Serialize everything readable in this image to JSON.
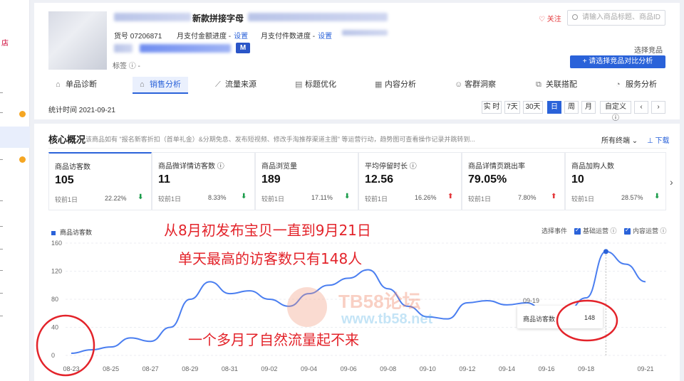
{
  "product": {
    "title": "新款拼接字母",
    "sku_label": "货号 07206871",
    "monthly_amount_progress": "月支付金额进度 -",
    "monthly_count_progress": "月支付件数进度 -",
    "set_label": "设置",
    "badge": "M",
    "tag_line": "标签 ⓘ   -"
  },
  "header": {
    "follow": "♡ 关注",
    "search_placeholder": "请输入商品标题、商品ID",
    "choose_label": "选择竞品",
    "compare_button": "+ 请选择竞品对比分析"
  },
  "tabs": [
    {
      "label": "单品诊断",
      "icon": "⌂"
    },
    {
      "label": "销售分析",
      "icon": "⌂"
    },
    {
      "label": "流量来源",
      "icon": "⟋"
    },
    {
      "label": "标题优化",
      "icon": "▤"
    },
    {
      "label": "内容分析",
      "icon": "▦"
    },
    {
      "label": "客群洞察",
      "icon": "☺"
    },
    {
      "label": "关联搭配",
      "icon": "⧉"
    },
    {
      "label": "服务分析",
      "icon": "◔"
    }
  ],
  "stat_time": "统计时间 2021-09-21",
  "time_buttons": [
    "实 时",
    "7天",
    "30天",
    "日",
    "周",
    "月",
    "自定义 ⓘ",
    "‹",
    "›"
  ],
  "core": {
    "title": "核心概况",
    "hint": "该商品如有 \"报名新客折扣（首单礼金）&分期免息、发布短视频、修改手淘推荐渠道主图\" 等运营行动，趋势图可查看操作记录并跳转到...",
    "all_channels": "所有终端 ⌄",
    "download": "⊥ 下载"
  },
  "metrics": [
    {
      "label": "商品访客数",
      "value": "105",
      "compare": "较前1日",
      "pct": "22.22%",
      "dir": "down"
    },
    {
      "label": "商品微详情访客数 ⓘ",
      "value": "11",
      "compare": "较前1日",
      "pct": "8.33%",
      "dir": "down"
    },
    {
      "label": "商品浏览量",
      "value": "189",
      "compare": "较前1日",
      "pct": "17.11%",
      "dir": "down"
    },
    {
      "label": "平均停留时长 ⓘ",
      "value": "12.56",
      "compare": "较前1日",
      "pct": "16.26%",
      "dir": "up"
    },
    {
      "label": "商品详情页跳出率",
      "value": "79.05%",
      "compare": "较前1日",
      "pct": "7.80%",
      "dir": "up"
    },
    {
      "label": "商品加购人数",
      "value": "10",
      "compare": "较前1日",
      "pct": "28.57%",
      "dir": "down"
    }
  ],
  "chart_legend": "商品访客数",
  "events": {
    "select": "选择事件",
    "basic": "基础运营 ⓘ",
    "content": "内容运营 ⓘ"
  },
  "tooltip": {
    "date": "09-19",
    "label": "商品访客数",
    "value": "148"
  },
  "annotations": {
    "line1": "从8月初发布宝贝一直到9月21日",
    "line2": "单天最高的访客数只有148人",
    "line3": "一个多月了自然流量起不来"
  },
  "watermark": {
    "brand": "TB58论坛",
    "url": "www.tb58.net"
  },
  "colors": {
    "accent": "#2a62d9",
    "annotation": "#e3232a",
    "line": "#4a7ef0"
  },
  "chart_data": {
    "type": "line",
    "title": "",
    "xlabel": "",
    "ylabel": "",
    "ylim": [
      0,
      160
    ],
    "yticks": [
      0,
      40,
      80,
      120,
      160
    ],
    "xtick_labels": [
      "08-23",
      "08-25",
      "08-27",
      "08-29",
      "08-31",
      "09-02",
      "09-04",
      "09-06",
      "09-08",
      "09-10",
      "09-12",
      "09-14",
      "09-16",
      "09-18",
      "09-21"
    ],
    "x": [
      "08-23",
      "08-24",
      "08-25",
      "08-26",
      "08-27",
      "08-28",
      "08-29",
      "08-30",
      "08-31",
      "09-01",
      "09-02",
      "09-03",
      "09-04",
      "09-05",
      "09-06",
      "09-07",
      "09-08",
      "09-09",
      "09-10",
      "09-11",
      "09-12",
      "09-13",
      "09-14",
      "09-15",
      "09-16",
      "09-17",
      "09-18",
      "09-19",
      "09-20",
      "09-21"
    ],
    "series": [
      {
        "name": "商品访客数",
        "values": [
          3,
          8,
          12,
          25,
          20,
          40,
          80,
          105,
          88,
          92,
          80,
          70,
          88,
          100,
          110,
          122,
          95,
          70,
          55,
          52,
          75,
          78,
          72,
          75,
          60,
          62,
          82,
          148,
          130,
          105
        ]
      }
    ]
  }
}
